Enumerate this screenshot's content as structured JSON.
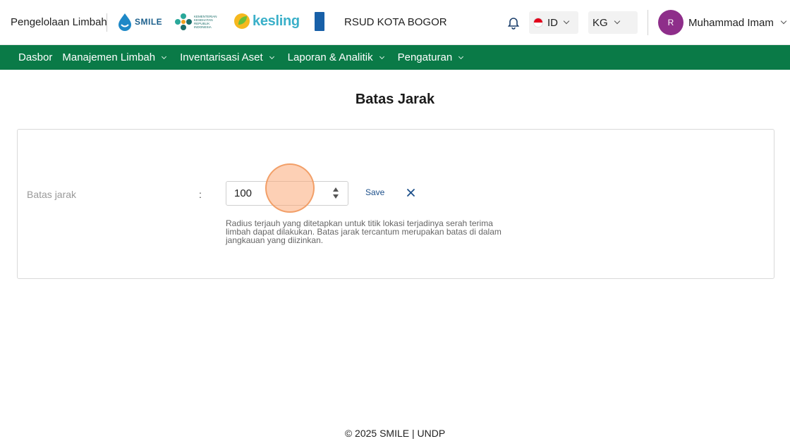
{
  "header": {
    "app_title": "Pengelolaan Limbah",
    "logos": {
      "smile": "SMILE",
      "kemenkes": "KEMENTERIAN KESEHATAN REPUBLIK INDONESIA",
      "kesling": "kesling",
      "undp": "UNDP"
    },
    "organization": "RSUD KOTA BOGOR",
    "notification_icon": "bell-icon",
    "language": {
      "selected": "ID",
      "flag_colors": [
        "#e2001a",
        "#ffffff"
      ]
    },
    "unit": {
      "selected": "KG"
    },
    "user": {
      "initial": "R",
      "name": "Muhammad Imam",
      "avatar_color": "#8e2e8a"
    }
  },
  "nav": {
    "items": [
      {
        "label": "Dasbor",
        "has_dropdown": false
      },
      {
        "label": "Manajemen Limbah",
        "has_dropdown": true
      },
      {
        "label": "Inventarisasi Aset",
        "has_dropdown": true
      },
      {
        "label": "Laporan & Analitik",
        "has_dropdown": true
      },
      {
        "label": "Pengaturan",
        "has_dropdown": true
      }
    ],
    "color": "#0a7a47"
  },
  "main": {
    "title": "Batas Jarak",
    "field": {
      "label": "Batas jarak",
      "separator": ":",
      "value": "100",
      "save_label": "Save",
      "cancel_icon": "close-icon",
      "help": "Radius terjauh yang ditetapkan untuk titik lokasi terjadinya serah terima limbah dapat dilakukan. Batas jarak tercantum merupakan batas di dalam jangkauan yang diizinkan."
    }
  },
  "footer": {
    "text": "© 2025 SMILE | UNDP"
  }
}
